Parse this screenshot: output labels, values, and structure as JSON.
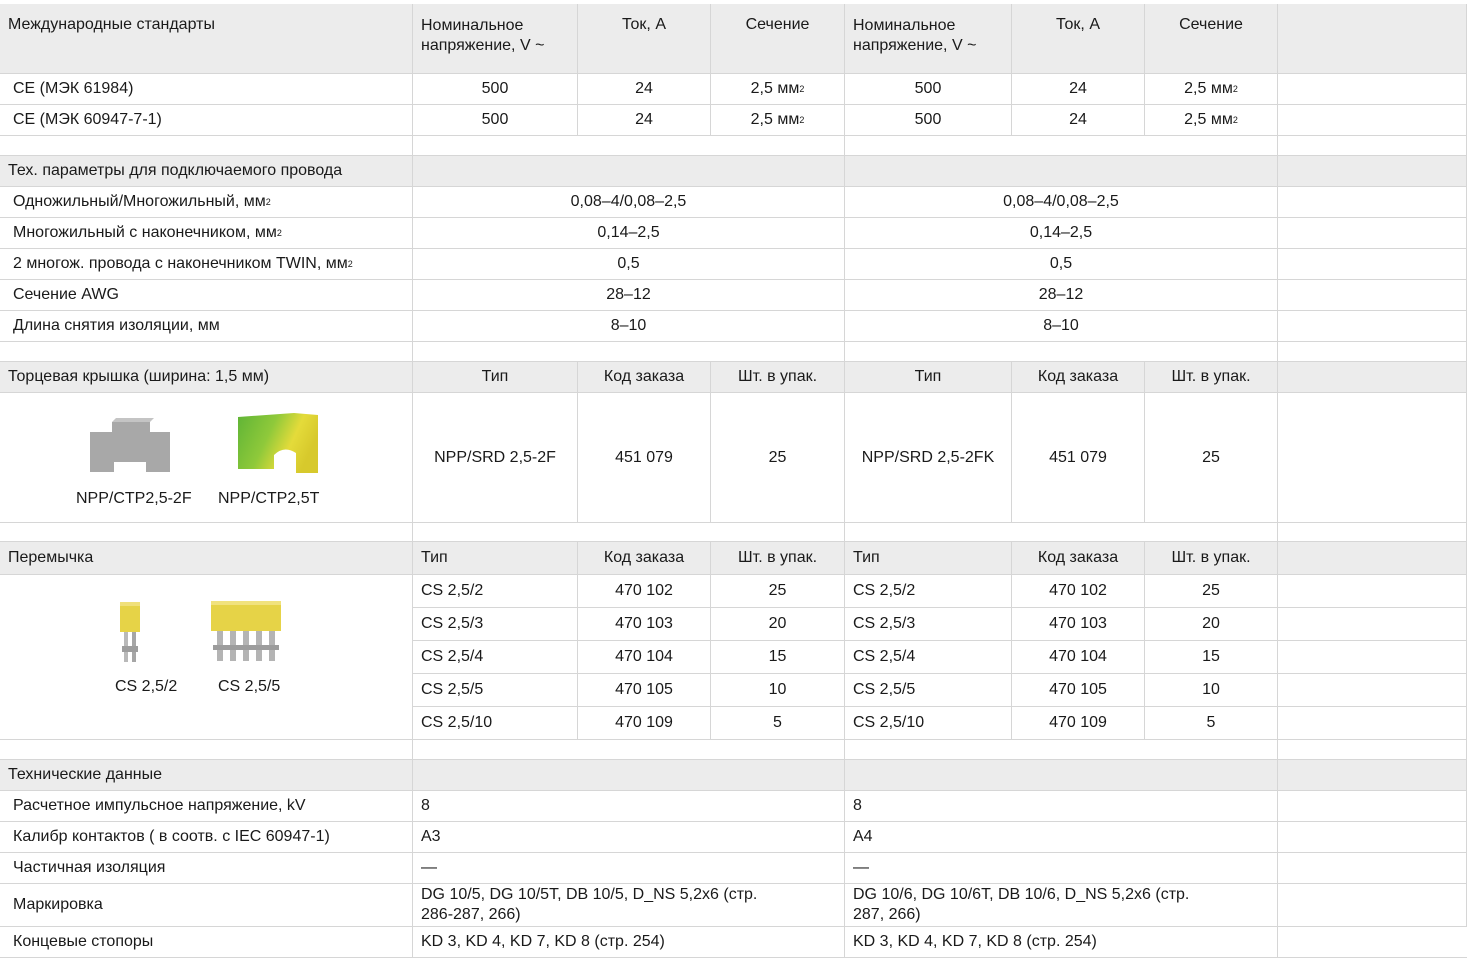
{
  "header": {
    "col1": "Международные стандарты",
    "voltage": "Номинальное напряжение, V ~",
    "current": "Ток, А",
    "section": "Сечение"
  },
  "standards": [
    {
      "name": "CE (МЭК 61984)",
      "v1": "500",
      "a1": "24",
      "s1": "2,5 мм",
      "v2": "500",
      "a2": "24",
      "s2": "2,5 мм"
    },
    {
      "name": "CE (МЭК 60947-7-1)",
      "v1": "500",
      "a1": "24",
      "s1": "2,5 мм",
      "v2": "500",
      "a2": "24",
      "s2": "2,5 мм"
    }
  ],
  "sup2": "2",
  "wire": {
    "title": "Тех. параметры для подключаемого провода",
    "rows": [
      {
        "label": "Одножильный/Многожильный, мм",
        "sup": true,
        "v1": "0,08–4/0,08–2,5",
        "v2": "0,08–4/0,08–2,5"
      },
      {
        "label": "Многожильный с наконечником, мм",
        "sup": true,
        "v1": "0,14–2,5",
        "v2": "0,14–2,5"
      },
      {
        "label": "2 многож. провода с наконечником TWIN, мм",
        "sup": true,
        "v1": "0,5",
        "v2": "0,5"
      },
      {
        "label": "Сечение AWG",
        "sup": false,
        "v1": "28–12",
        "v2": "28–12"
      },
      {
        "label": "Длина снятия изоляции, мм",
        "sup": false,
        "v1": "8–10",
        "v2": "8–10"
      }
    ]
  },
  "endcap": {
    "title": "Торцевая крышка (ширина: 1,5 мм)",
    "type_h": "Тип",
    "code_h": "Код заказа",
    "qty_h": "Шт. в упак.",
    "img1": "NPP/CTP2,5-2F",
    "img2": "NPP/CTP2,5T",
    "type1": "NPP/SRD 2,5-2F",
    "code1": "451 079",
    "qty1": "25",
    "type2": "NPP/SRD 2,5-2FK",
    "code2": "451 079",
    "qty2": "25",
    "colors": {
      "grey": "#a9a9a9",
      "green": "#6cbf3a",
      "yellow": "#e8dd3c"
    }
  },
  "jumper": {
    "title": "Перемычка",
    "type_h": "Тип",
    "code_h": "Код заказа",
    "qty_h": "Шт. в упак.",
    "img1": "CS 2,5/2",
    "img2": "CS 2,5/5",
    "rows": [
      {
        "type": "CS 2,5/2",
        "code": "470 102",
        "qty": "25"
      },
      {
        "type": "CS 2,5/3",
        "code": "470 103",
        "qty": "20"
      },
      {
        "type": "CS 2,5/4",
        "code": "470 104",
        "qty": "15"
      },
      {
        "type": "CS 2,5/5",
        "code": "470 105",
        "qty": "10"
      },
      {
        "type": "CS 2,5/10",
        "code": "470 109",
        "qty": "5"
      }
    ]
  },
  "tech": {
    "title": "Технические данные",
    "rows": [
      {
        "label": "Расчетное импульсное напряжение, kV",
        "v1": "8",
        "v2": "8"
      },
      {
        "label": "Калибр контактов ( в соотв. с IEC 60947-1)",
        "v1": "A3",
        "v2": "A4"
      },
      {
        "label": "Частичная изоляция",
        "v1": "—",
        "v2": "—"
      },
      {
        "label": "Маркировка",
        "v1": "DG 10/5, DG 10/5T, DB 10/5, D_NS 5,2x6 (стр. 286-287, 266)",
        "v2": "DG 10/6, DG 10/6T, DB 10/6, D_NS 5,2x6 (стр. 287, 266)"
      },
      {
        "label": "Концевые стопоры",
        "v1": "KD 3, KD 4, KD 7, KD 8 (стр. 254)",
        "v2": "KD 3, KD 4, KD 7, KD 8 (стр. 254)"
      }
    ]
  }
}
